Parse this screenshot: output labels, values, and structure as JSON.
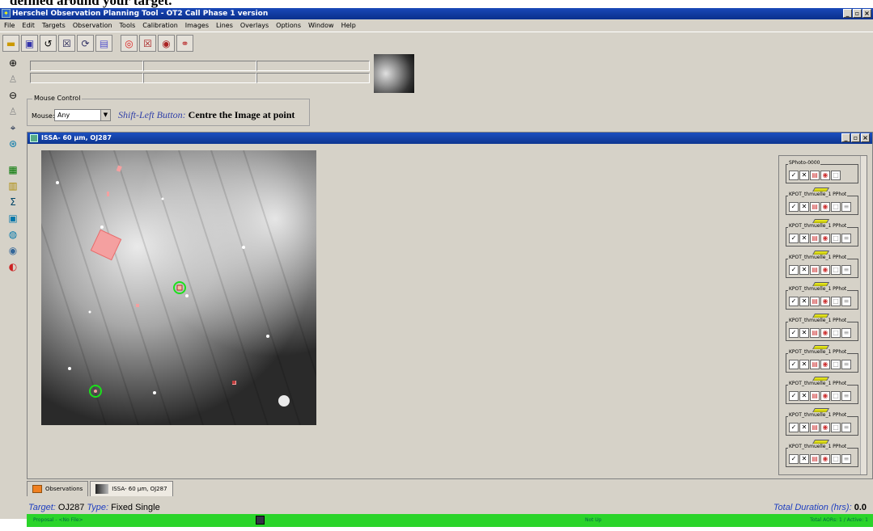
{
  "caption": "defined around your target.",
  "window": {
    "title": "Herschel Observation Planning Tool - OT2 Call Phase 1 version"
  },
  "menu": [
    "File",
    "Edit",
    "Targets",
    "Observation",
    "Tools",
    "Calibration",
    "Images",
    "Lines",
    "Overlays",
    "Options",
    "Window",
    "Help"
  ],
  "mouse_control": {
    "legend": "Mouse Control",
    "label": "Mouse:",
    "value": "Any",
    "hint_key": "Shift-Left Button:",
    "hint_action": "Centre the Image at point"
  },
  "image_window": {
    "title": "ISSA- 60 µm,  OJ287"
  },
  "obs_groups": [
    {
      "name": "SPhoto-0000"
    },
    {
      "name": "KPOT_thmuelle_1 PPhot"
    },
    {
      "name": "KPOT_thmuelle_1 PPhot"
    },
    {
      "name": "KPOT_thmuelle_1 PPhot"
    },
    {
      "name": "KPOT_thmuelle_1 PPhot"
    },
    {
      "name": "KPOT_thmuelle_1 PPhot"
    },
    {
      "name": "KPOT_thmuelle_1 PPhot"
    },
    {
      "name": "KPOT_thmuelle_1 PPhot"
    },
    {
      "name": "KPOT_thmuelle_1 PPhot"
    },
    {
      "name": "KPOT_thmuelle_1 PPhot"
    }
  ],
  "tabs": [
    {
      "label": "Observations"
    },
    {
      "label": "ISSA- 60 µm,  OJ287"
    }
  ],
  "target": {
    "label": "Target:",
    "name": "OJ287",
    "type_label": "Type:",
    "type": "Fixed Single",
    "duration_label": "Total Duration (hrs):",
    "duration": "0.0"
  },
  "status": {
    "left": "Proposal - <No File>",
    "mid": "Not Up",
    "right": "Total AORs: 1  / Active: 1"
  }
}
